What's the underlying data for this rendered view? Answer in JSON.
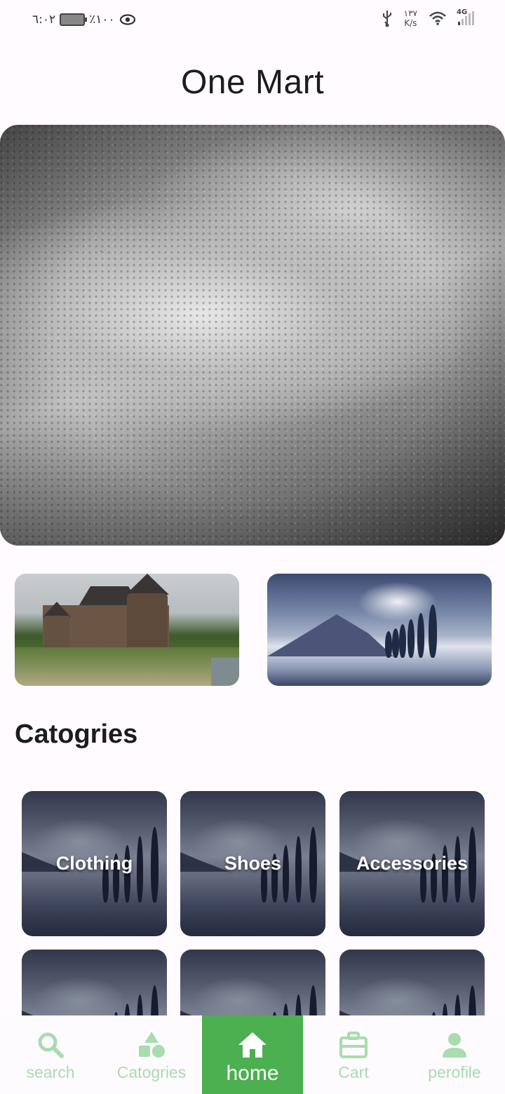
{
  "status_bar": {
    "time": "٦:٠٢",
    "battery": "٪١٠٠",
    "speed_value": "١٣٧",
    "speed_unit": "K/s",
    "network": "4G"
  },
  "app": {
    "title": "One Mart"
  },
  "banner": {
    "hero_icon": "rain-drops-photo",
    "thumb1_icon": "castle-photo",
    "thumb2_icon": "winter-landscape-photo"
  },
  "categories": {
    "title": "Catogries",
    "items": [
      {
        "label": "Clothing"
      },
      {
        "label": "Shoes"
      },
      {
        "label": "Accessories"
      },
      {
        "label": ""
      },
      {
        "label": ""
      },
      {
        "label": ""
      }
    ]
  },
  "bottom_nav": {
    "items": [
      {
        "label": "search",
        "icon": "search-icon"
      },
      {
        "label": "Catogries",
        "icon": "shapes-icon"
      },
      {
        "label": "home",
        "icon": "home-icon",
        "active": true
      },
      {
        "label": "Cart",
        "icon": "briefcase-icon"
      },
      {
        "label": "perofile",
        "icon": "person-icon"
      }
    ]
  },
  "colors": {
    "accent": "#4caf50",
    "nav_inactive": "#a9dcae",
    "background": "#fffbfe"
  }
}
